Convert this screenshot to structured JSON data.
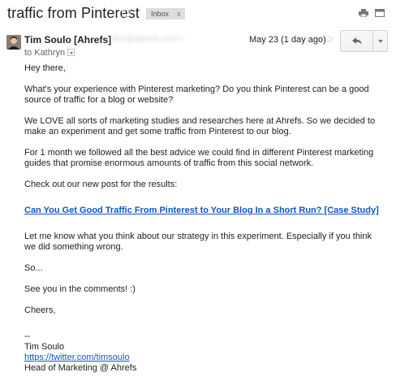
{
  "subject": "traffic from Pinterest",
  "label": {
    "name": "Inbox",
    "remove": "x"
  },
  "icons": {
    "label_tag": "label-tag-icon",
    "print": "print-icon",
    "new_window": "new-window-icon",
    "star": "star-icon",
    "reply": "reply-arrow-icon",
    "more": "chevron-down-icon",
    "to_details": "caret-down-icon"
  },
  "sender": {
    "name": "Tim Soulo [Ahrefs]",
    "email": "<tim@ahrefs.com>",
    "date": "May 23 (1 day ago)"
  },
  "recipient": "to Kathryn",
  "body": {
    "greeting": "Hey there,",
    "p1": "What's your experience with Pinterest marketing? Do you think Pinterest can be a good source of traffic for a blog or website?",
    "p2": "We LOVE all sorts of marketing studies and researches here at Ahrefs. So we decided to make an experiment and get some traffic from Pinterest to our blog.",
    "p3": "For 1 month we followed all the best advice we could find in different Pinterest marketing guides that promise enormous amounts of traffic from this social network.",
    "p4": "Check out our new post for the results:",
    "case_link": "Can You Get Good Traffic From Pinterest to Your Blog In a Short Run? [Case Study]",
    "p5": "Let me know what you think about our strategy in this experiment. Especially if you think we did something wrong.",
    "so": "So...",
    "see_you": "See you in the comments! :)",
    "cheers": "Cheers,"
  },
  "signature": {
    "dashes": "--",
    "name": "Tim Soulo",
    "twitter": "https://twitter.com/timsoulo",
    "title": "Head of Marketing @ Ahrefs"
  },
  "colors": {
    "link": "#1155cc",
    "label_bg": "#dddddd"
  }
}
